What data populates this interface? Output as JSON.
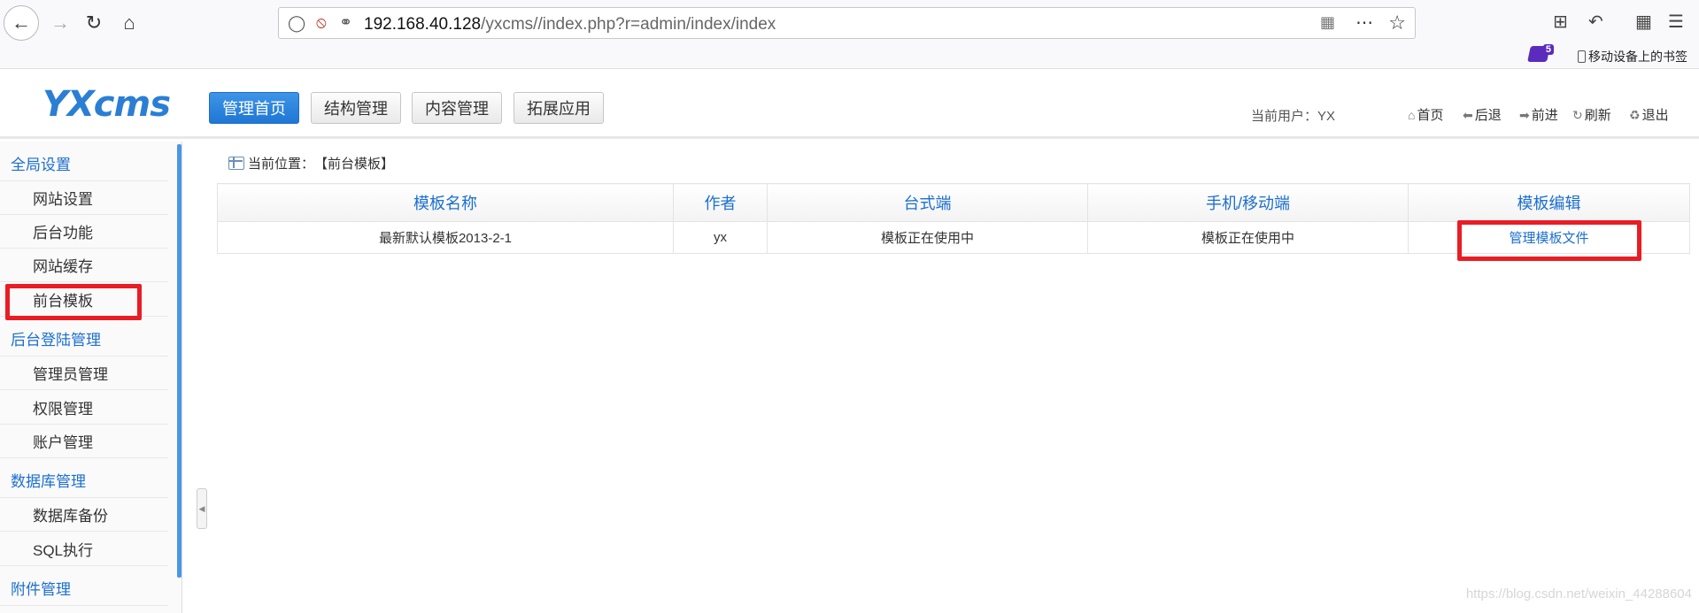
{
  "browser": {
    "url_host": "192.168.40.128",
    "url_path": "/yxcms//index.php?r=admin/index/index",
    "bookmark_badge": "5",
    "bookmark_label": "移动设备上的书签"
  },
  "header": {
    "logo": "YXcms",
    "tabs": [
      {
        "label": "管理首页",
        "active": true
      },
      {
        "label": "结构管理",
        "active": false
      },
      {
        "label": "内容管理",
        "active": false
      },
      {
        "label": "拓展应用",
        "active": false
      }
    ],
    "user_prefix": "当前用户：",
    "user_name": "YX",
    "quick_links": [
      {
        "label": "首页",
        "icon": "home-icon"
      },
      {
        "label": "后退",
        "icon": "arrow-left-icon"
      },
      {
        "label": "前进",
        "icon": "arrow-right-icon"
      },
      {
        "label": "刷新",
        "icon": "refresh-icon"
      },
      {
        "label": "退出",
        "icon": "logout-icon"
      }
    ]
  },
  "sidebar": {
    "groups": [
      {
        "title": "全局设置",
        "items": [
          "网站设置",
          "后台功能",
          "网站缓存",
          "前台模板"
        ]
      },
      {
        "title": "后台登陆管理",
        "items": [
          "管理员管理",
          "权限管理",
          "账户管理"
        ]
      },
      {
        "title": "数据库管理",
        "items": [
          "数据库备份",
          "SQL执行"
        ]
      },
      {
        "title": "附件管理",
        "items": []
      }
    ]
  },
  "main": {
    "breadcrumb_label": "当前位置：",
    "breadcrumb_value": "【前台模板】",
    "table": {
      "headers": [
        "模板名称",
        "作者",
        "台式端",
        "手机/移动端",
        "模板编辑"
      ],
      "rows": [
        {
          "name": "最新默认模板2013-2-1",
          "author": "yx",
          "desktop": "模板正在使用中",
          "mobile": "模板正在使用中",
          "edit": "管理模板文件"
        }
      ]
    }
  },
  "watermark": "https://blog.csdn.net/weixin_44288604",
  "colors": {
    "accent": "#1c6fcf",
    "active_tab": "#2a86e0",
    "status_red": "#e01818",
    "highlight": "#ea1c24"
  }
}
